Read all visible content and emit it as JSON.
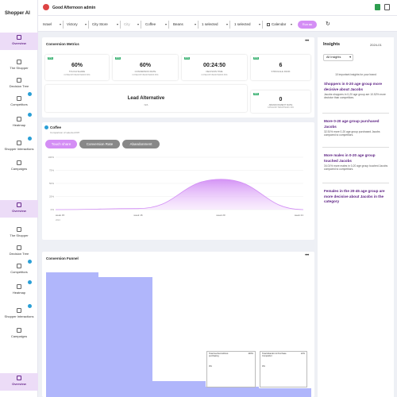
{
  "app": {
    "brand": "Shopper AI",
    "greeting": "Good Afternoon admin"
  },
  "sidebar": {
    "groups": [
      [
        "Overview",
        "The Shopper",
        "Decision Tree",
        "Competitors",
        "Heatmap",
        "Shopper Interactions",
        "Campaigns"
      ],
      [
        "Overview",
        "The Shopper",
        "Decision Tree",
        "Competitors",
        "Heatmap",
        "Shopper Interactions",
        "Campaigns"
      ],
      [
        "Overview"
      ]
    ]
  },
  "filters": {
    "items": [
      "Israel",
      "Victory",
      "City Store",
      "City",
      "Coffee",
      "Beans",
      "1 selected",
      "1 selected",
      "Calendar"
    ],
    "run_label": "Run ▸▸"
  },
  "metrics": {
    "title": "Conversion Metrics",
    "cards": [
      {
        "tag": "87%",
        "value": "60%",
        "caption": "TOUCH SHARE",
        "sub": "CATEGORY BENCHMARK 80%"
      },
      {
        "tag": "87%",
        "value": "60%",
        "caption": "CONVERSION RATE",
        "sub": "CATEGORY BENCHMARK 80%"
      },
      {
        "tag": "87%",
        "value": "00:24:50",
        "caption": "DECISION TIME",
        "sub": "CATEGORY BENCHMARK 80%"
      },
      {
        "tag": "87%",
        "value": "6",
        "caption": "STRUGGLE RANK",
        "sub": ""
      }
    ],
    "lead": {
      "value": "Lead Alternative",
      "caption": "N/A"
    },
    "abandon": {
      "tag": "30%",
      "value": "0",
      "caption": "ABANDONMENT RATE",
      "sub": "CATEGORY BENCHMARK 30%"
    }
  },
  "coffee": {
    "title": "Coffee",
    "subtitle": "Comparison of selected KPI",
    "tabs": [
      "Touch share",
      "Conversion Rate",
      "Abandonment"
    ],
    "chart_data": {
      "type": "area",
      "x": [
        "week 15",
        "week 16",
        "week 20",
        "week 21"
      ],
      "year_label": "2024",
      "y_ticks": [
        "100%",
        "75%",
        "50%",
        "25%",
        "0%"
      ],
      "series": [
        {
          "values": [
            0,
            2,
            58,
            0
          ]
        }
      ],
      "ylim": [
        0,
        100
      ],
      "color": "#d28ef5"
    }
  },
  "funnel": {
    "title": "Conversion Funnel",
    "tooltips": [
      {
        "title": "Total touched without purchasing",
        "pct": "100%",
        "value": "0%"
      },
      {
        "title": "Total Abandon & Purchase Competitor",
        "pct": "12%",
        "value": "0%"
      }
    ]
  },
  "insights": {
    "title": "Insights",
    "date": "2024-01",
    "select": "All Insights",
    "count_text": "10 important insights for your brand",
    "items": [
      {
        "h": "Shoppers in 0-20 age group more decisive about Jacobs",
        "d": "Jacobs shoppers in 0-20 age group are 10.52% more decisive than competitors."
      },
      {
        "h": "More 0-20 age group purchased Jacobs",
        "d": "32.51% more 0-20 age group purchased Jacobs compared to competitors."
      },
      {
        "h": "More males in 0-20 age group touched Jacobs",
        "d": "34.01% more males in 0-20 age group touched Jacobs compared to competitors."
      },
      {
        "h": "Females in the 20-45 age group are more decisive about Jacobs in the category",
        "d": ""
      }
    ]
  },
  "colors": {
    "accent": "#d48ef5",
    "funnel": "#b0b6fb",
    "active_nav": "#ecdcf7"
  }
}
